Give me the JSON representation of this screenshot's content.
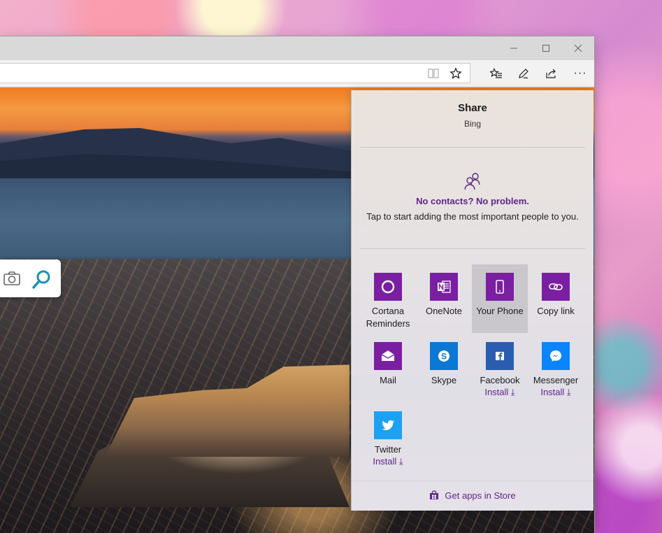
{
  "browser": {
    "window_controls": {
      "minimize": "minimize-icon",
      "maximize": "maximize-icon",
      "close": "close-icon"
    },
    "toolbar_icons": [
      "reading-view-icon",
      "favorite-star-icon",
      "favorites-hub-icon",
      "pen-icon",
      "share-icon",
      "more-icon"
    ],
    "more_label": "···"
  },
  "share": {
    "title": "Share",
    "subtitle": "Bing",
    "contacts": {
      "heading": "No contacts? No problem.",
      "text": "Tap to start adding the most important people to you."
    },
    "apps": [
      {
        "label": "Cortana",
        "label2": "Reminders",
        "install": "",
        "color": "#7a1fa2",
        "icon": "cortana-icon"
      },
      {
        "label": "OneNote",
        "label2": "",
        "install": "",
        "color": "#7a1fa2",
        "icon": "onenote-icon"
      },
      {
        "label": "Your Phone",
        "label2": "",
        "install": "",
        "color": "#7a1fa2",
        "icon": "phone-icon",
        "selected": true
      },
      {
        "label": "Copy link",
        "label2": "",
        "install": "",
        "color": "#7a1fa2",
        "icon": "link-icon"
      },
      {
        "label": "Mail",
        "label2": "",
        "install": "",
        "color": "#7a1fa2",
        "icon": "mail-icon"
      },
      {
        "label": "Skype",
        "label2": "",
        "install": "",
        "color": "#0a78d4",
        "icon": "skype-icon"
      },
      {
        "label": "Facebook",
        "label2": "",
        "install": "Install ⤓",
        "color": "#2a5db0",
        "icon": "facebook-icon"
      },
      {
        "label": "Messenger",
        "label2": "",
        "install": "Install ⤓",
        "color": "#0a84ff",
        "icon": "messenger-icon"
      },
      {
        "label": "Twitter",
        "label2": "",
        "install": "Install ⤓",
        "color": "#1da1f2",
        "icon": "twitter-icon"
      }
    ],
    "store_link": "Get apps in Store"
  },
  "colors": {
    "accent": "#5f2588",
    "tile_purple": "#7a1fa2"
  }
}
